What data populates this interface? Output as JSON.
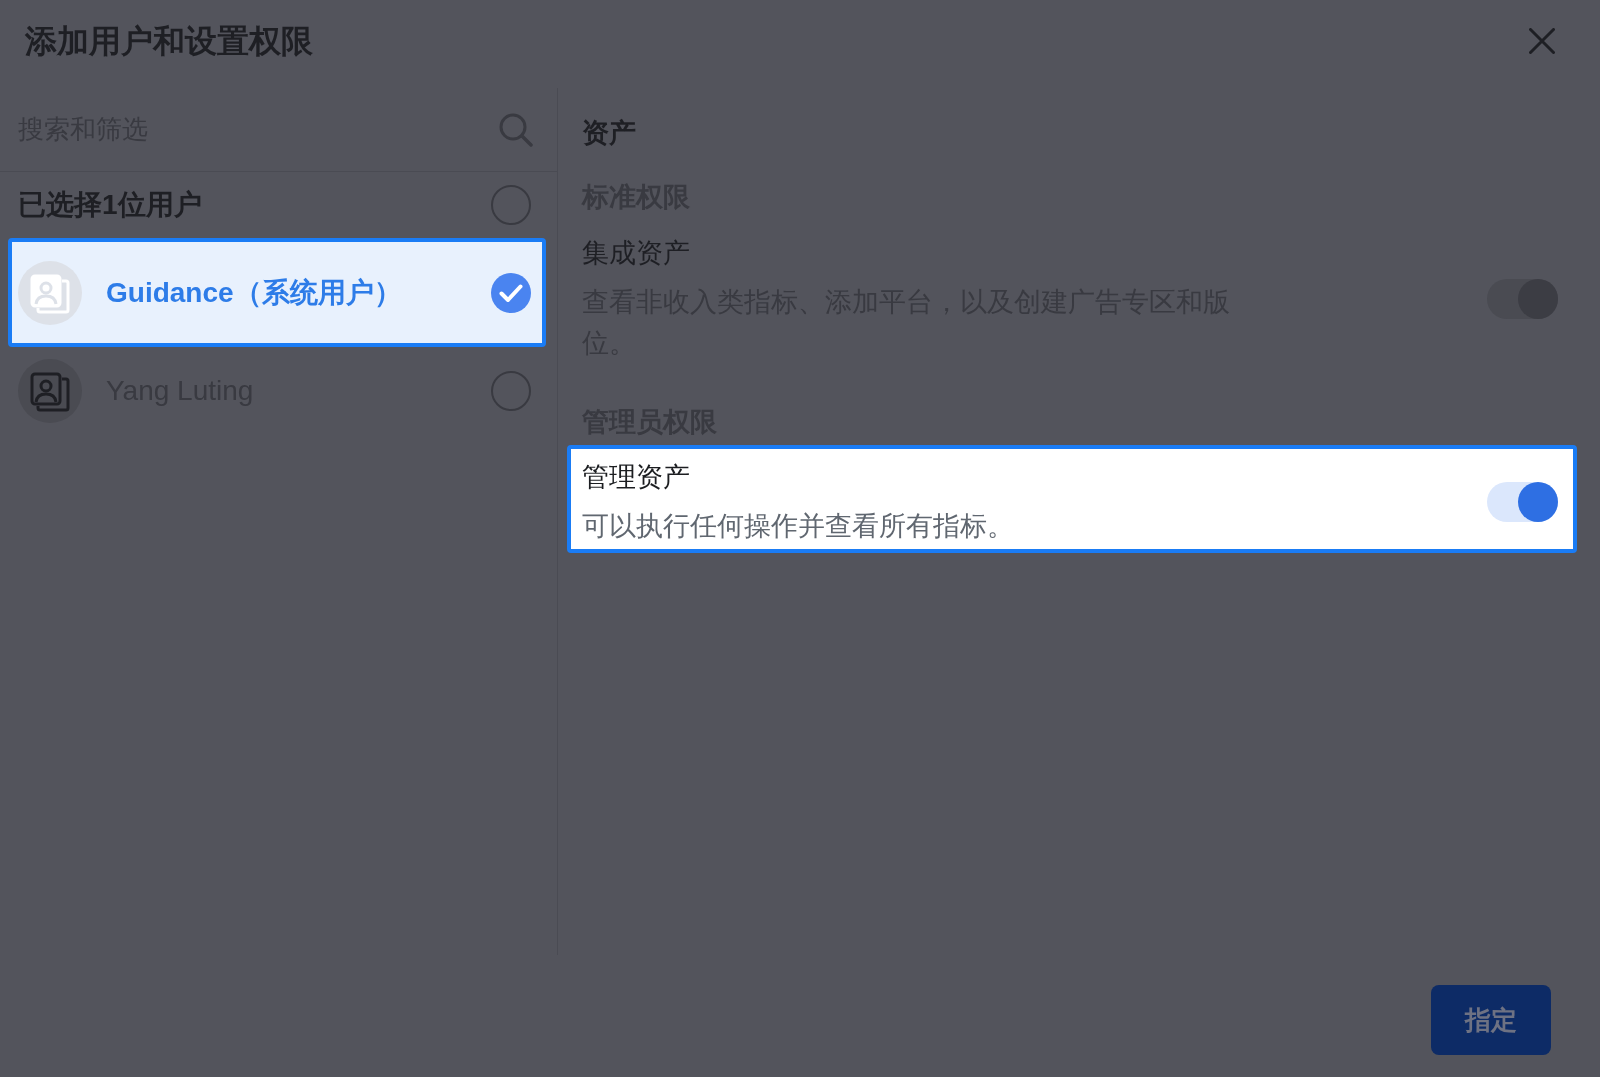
{
  "dialog": {
    "title": "添加用户和设置权限"
  },
  "search": {
    "placeholder": "搜索和筛选"
  },
  "selection": {
    "label": "已选择1位用户",
    "checked": false
  },
  "users": [
    {
      "name": "Guidance（系统用户）",
      "selected": true,
      "highlighted": true
    },
    {
      "name": "Yang Luting",
      "selected": false,
      "highlighted": false
    }
  ],
  "permissions": {
    "title": "资产",
    "groups": [
      {
        "title": "标准权限",
        "items": [
          {
            "name": "集成资产",
            "description": "查看非收入类指标、添加平台，以及创建广告专区和版位。",
            "on": true,
            "disabled": true,
            "highlighted": false
          }
        ]
      },
      {
        "title": "管理员权限",
        "items": [
          {
            "name": "管理资产",
            "description": "可以执行任何操作并查看所有指标。",
            "on": true,
            "disabled": false,
            "highlighted": true
          }
        ]
      }
    ]
  },
  "footer": {
    "button": "指定"
  }
}
